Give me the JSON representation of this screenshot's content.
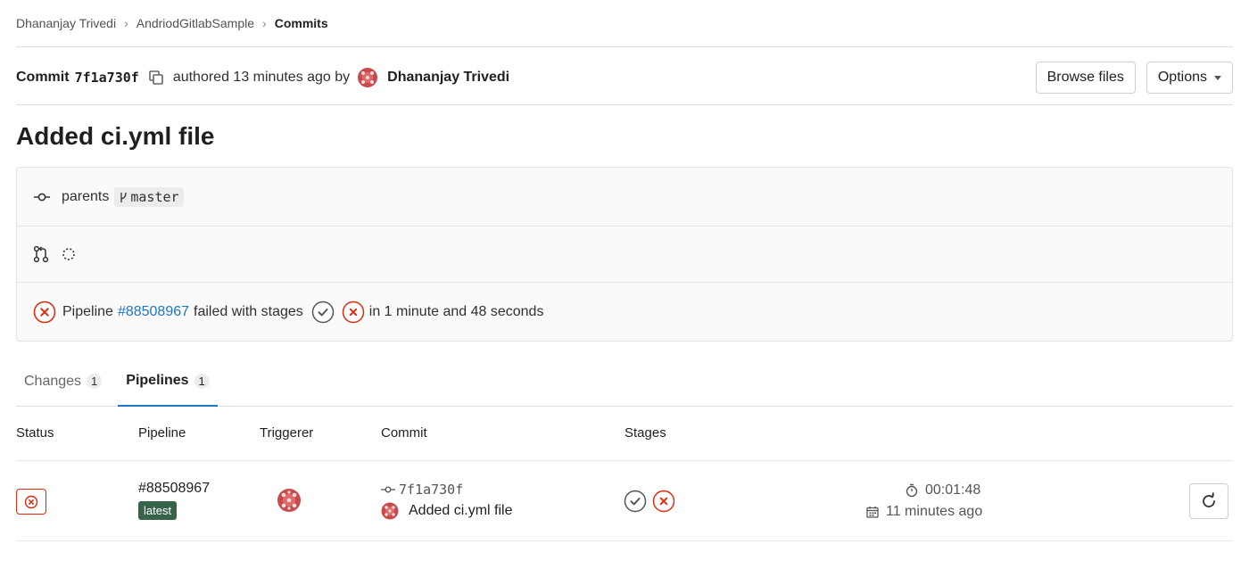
{
  "breadcrumb": {
    "items": [
      "Dhananjay Trivedi",
      "AndriodGitlabSample",
      "Commits"
    ]
  },
  "commit": {
    "label": "Commit",
    "sha": "7f1a730f",
    "authored_text": "authored 13 minutes ago by",
    "author": "Dhananjay Trivedi",
    "browse_files": "Browse files",
    "options": "Options",
    "title": "Added ci.yml file"
  },
  "info": {
    "parents_label": "parents",
    "branch": "master",
    "pipeline_prefix": "Pipeline",
    "pipeline_link": "#88508967",
    "pipeline_middle": "failed with stages",
    "pipeline_suffix": "in 1 minute and 48 seconds"
  },
  "tabs": [
    {
      "label": "Changes",
      "count": "1"
    },
    {
      "label": "Pipelines",
      "count": "1"
    }
  ],
  "table": {
    "headers": [
      "Status",
      "Pipeline",
      "Triggerer",
      "Commit",
      "Stages"
    ],
    "row": {
      "pipeline_id": "#88508967",
      "badge": "latest",
      "commit_sha": "7f1a730f",
      "commit_message": "Added ci.yml file",
      "duration": "00:01:48",
      "finished": "11 minutes ago"
    }
  },
  "colors": {
    "failed": "#dd2b0e",
    "passed": "#555555",
    "link": "#1f75cb",
    "badge": "#36634a"
  }
}
